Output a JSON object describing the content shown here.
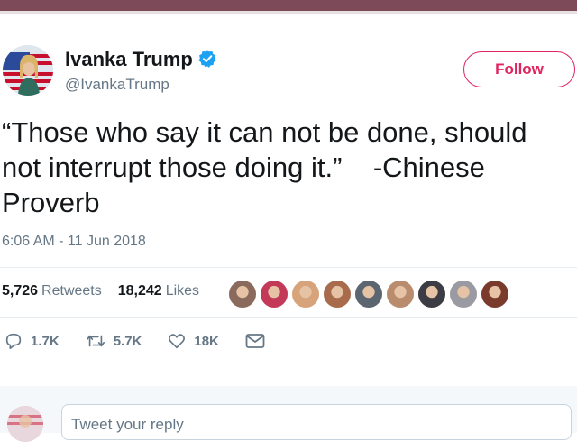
{
  "header": {
    "display_name": "Ivanka Trump",
    "handle": "@IvankaTrump",
    "verified_icon": "verified-badge-icon",
    "follow_label": "Follow"
  },
  "tweet": {
    "text": "“Those who say it can not be done, should\nnot interrupt those doing it.”    -Chinese\nProverb",
    "timestamp": "6:06 AM - 11 Jun 2018"
  },
  "stats": {
    "retweets_count": "5,726",
    "retweets_label": "Retweets",
    "likes_count": "18,242",
    "likes_label": "Likes",
    "liker_avatar_colors": [
      "#8a6a5c",
      "#c23a58",
      "#d7a37a",
      "#a86c4c",
      "#5b6670",
      "#b88c6c",
      "#3c3c44",
      "#9a9aa2",
      "#7a3a2c"
    ]
  },
  "actions": {
    "reply_icon": "reply-icon",
    "reply_count": "1.7K",
    "retweet_icon": "retweet-icon",
    "retweet_count": "5.7K",
    "like_icon": "heart-icon",
    "like_count": "18K",
    "dm_icon": "envelope-icon"
  },
  "reply": {
    "placeholder": "Tweet your reply"
  },
  "colors": {
    "accent": "#e0245e",
    "verified": "#1da1f2",
    "muted": "#657786",
    "topbar": "#7d4a5a"
  }
}
